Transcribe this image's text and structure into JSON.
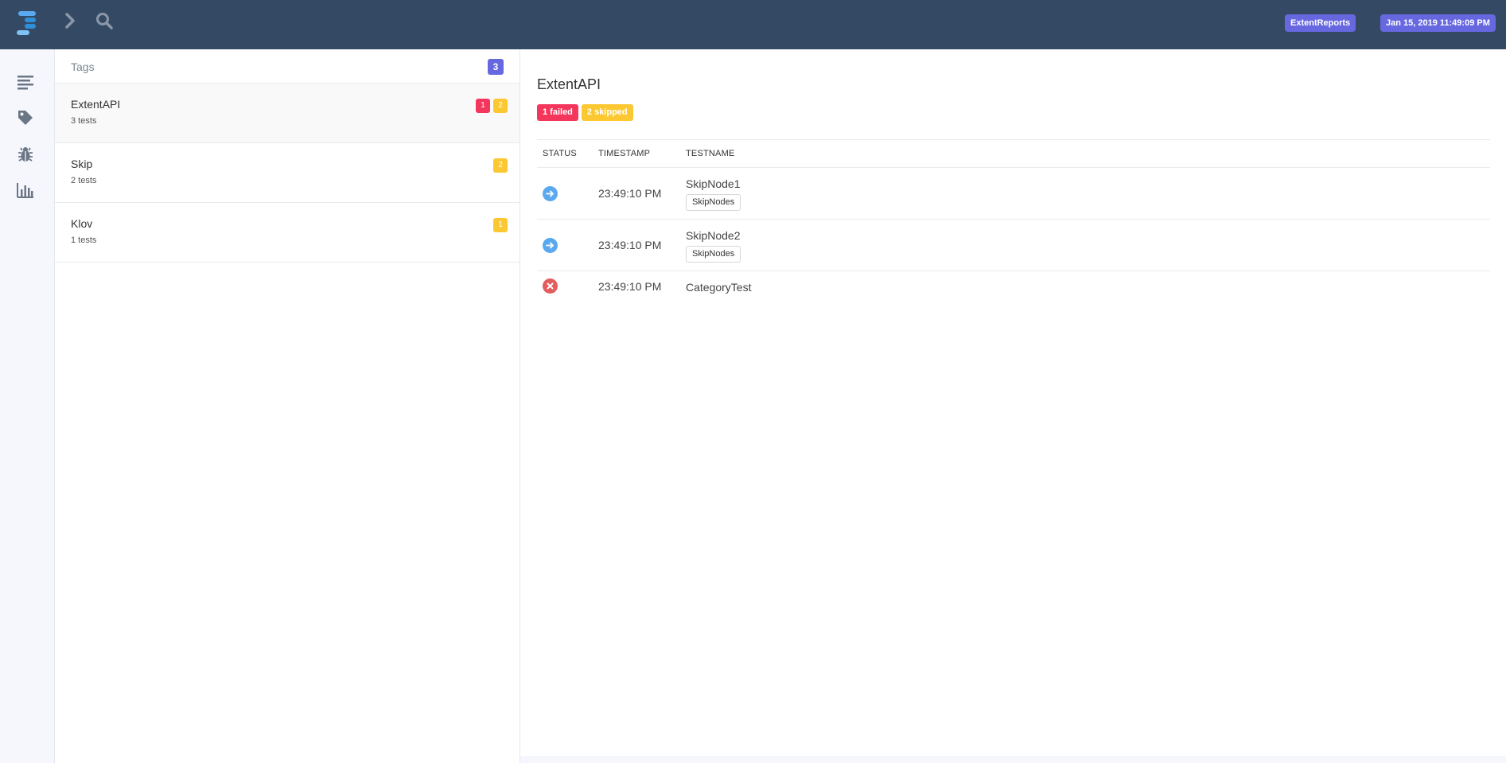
{
  "topbar": {
    "brand_badge": "ExtentReports",
    "date_badge": "Jan 15, 2019 11:49:09 PM",
    "logo_colors": [
      "#5aa9f0",
      "#2f8fd8",
      "#7ec2f7"
    ]
  },
  "sidebar": {
    "items": [
      {
        "icon": "list-icon"
      },
      {
        "icon": "tag-icon"
      },
      {
        "icon": "bug-icon"
      },
      {
        "icon": "bar-chart-icon"
      }
    ]
  },
  "tags": {
    "header": "Tags",
    "count": "3",
    "items": [
      {
        "name": "ExtentAPI",
        "sub": "3 tests",
        "failed": "1",
        "skipped": "2"
      },
      {
        "name": "Skip",
        "sub": "2 tests",
        "skipped": "2"
      },
      {
        "name": "Klov",
        "sub": "1 tests",
        "skipped": "1"
      }
    ]
  },
  "detail": {
    "title": "ExtentAPI",
    "failed_label": "1 failed",
    "skipped_label": "2 skipped",
    "columns": [
      "STATUS",
      "TIMESTAMP",
      "TESTNAME"
    ],
    "rows": [
      {
        "status": "skip",
        "timestamp": "23:49:10 PM",
        "name": "SkipNode1",
        "node": "SkipNodes"
      },
      {
        "status": "skip",
        "timestamp": "23:49:10 PM",
        "name": "SkipNode2",
        "node": "SkipNodes"
      },
      {
        "status": "fail",
        "timestamp": "23:49:10 PM",
        "name": "CategoryTest"
      }
    ]
  },
  "colors": {
    "topbar": "#344a64",
    "accent": "#6768e0",
    "fail": "#f5365c",
    "skip": "#fbc832",
    "skip_icon": "#5aa9f0",
    "fail_icon": "#e35d5d"
  }
}
